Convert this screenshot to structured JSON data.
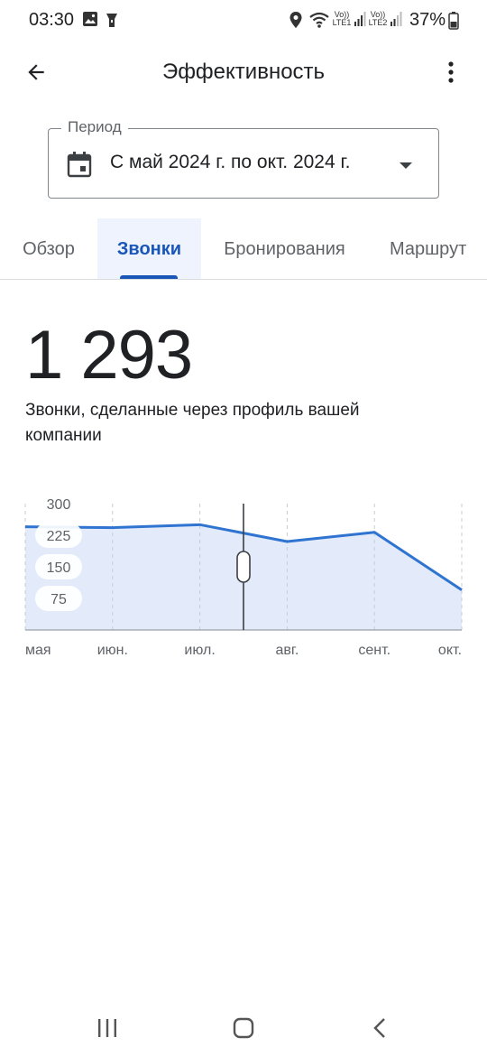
{
  "status_bar": {
    "time": "03:30",
    "battery": "37%",
    "lte1": "LTE1",
    "lte2": "LTE2",
    "volte": "Vo))"
  },
  "app_bar": {
    "title": "Эффективность",
    "back_icon": "arrow-back-icon",
    "more_icon": "more-vert-icon"
  },
  "period": {
    "label": "Период",
    "value": "С май 2024 г. по окт. 2024 г.",
    "icon": "calendar-icon"
  },
  "tabs": [
    {
      "label": "Обзор",
      "active": false
    },
    {
      "label": "Звонки",
      "active": true
    },
    {
      "label": "Бронирования",
      "active": false
    },
    {
      "label": "Маршрут",
      "active": false
    }
  ],
  "metric": {
    "value": "1 293",
    "description": "Звонки, сделанные через профиль вашей компании"
  },
  "colors": {
    "accent": "#1a56b8",
    "line": "#2f74d0",
    "area": "#e3ebfb"
  },
  "chart_data": {
    "type": "area",
    "x": [
      "мая",
      "июн.",
      "июл.",
      "авг.",
      "сент.",
      "окт."
    ],
    "values": [
      245,
      243,
      250,
      210,
      232,
      95
    ],
    "y_ticks": [
      300,
      225,
      150,
      75
    ],
    "ylim": [
      0,
      300
    ],
    "cursor_position": 2.5,
    "grid": true
  },
  "nav_bar": {
    "recent_icon": "recent-apps-icon",
    "home_icon": "home-icon",
    "back_icon": "nav-back-icon"
  }
}
